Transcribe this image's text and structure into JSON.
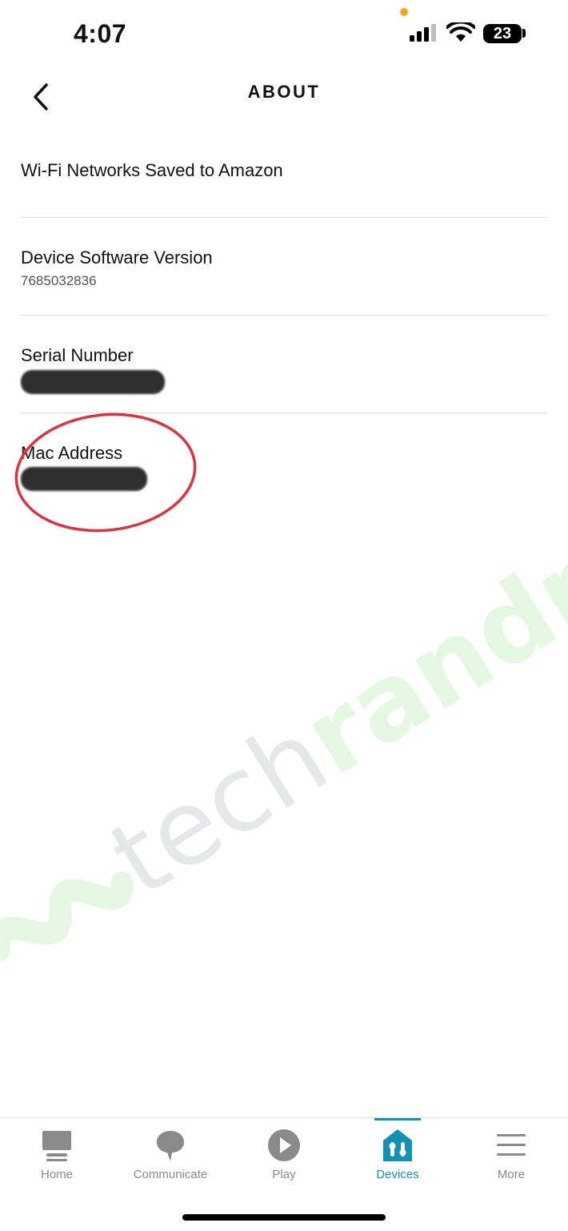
{
  "status_bar": {
    "time": "4:07",
    "battery": "23"
  },
  "header": {
    "title": "ABOUT"
  },
  "about": {
    "wifi_label": "Wi-Fi Networks Saved to Amazon",
    "software_label": "Device Software Version",
    "software_value": "7685032836",
    "serial_label": "Serial Number",
    "mac_label": "Mac Address"
  },
  "watermark": {
    "text_a": "tech",
    "text_b": "randm"
  },
  "tabs": [
    {
      "label": "Home",
      "icon": "home-icon"
    },
    {
      "label": "Communicate",
      "icon": "chat-bubble-icon"
    },
    {
      "label": "Play",
      "icon": "play-icon"
    },
    {
      "label": "Devices",
      "icon": "devices-icon",
      "active": true
    },
    {
      "label": "More",
      "icon": "menu-icon"
    }
  ],
  "colors": {
    "accent": "#1391b3",
    "highlight": "#d9343f",
    "inactive": "#8a8a8a"
  }
}
